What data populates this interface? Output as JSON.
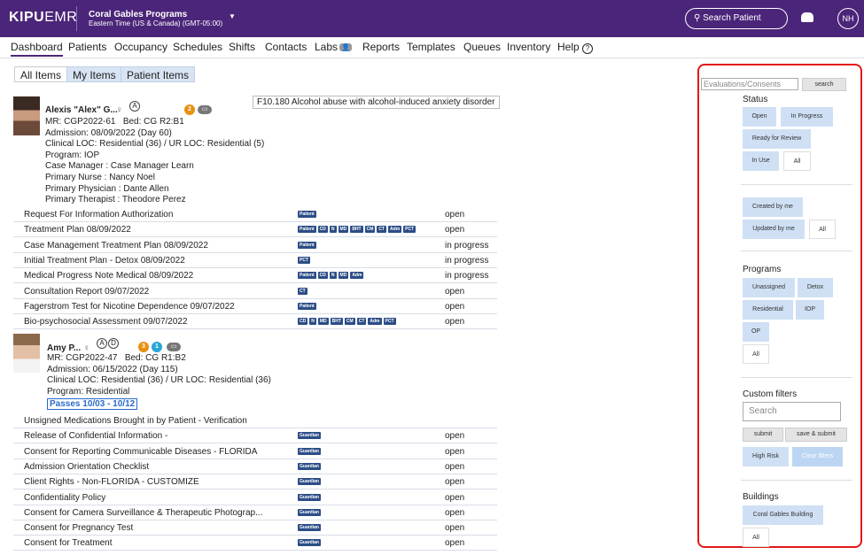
{
  "header": {
    "logo_bold": "KIPU",
    "logo_light": "EMR",
    "program_title": "Coral Gables Programs",
    "program_timezone": "Eastern Time (US & Canada) (GMT-05:00)",
    "search_patient": "Search Patient",
    "user_initials": "NH"
  },
  "nav": {
    "dashboard": "Dashboard",
    "patients": "Patients",
    "occupancy": "Occupancy",
    "schedules": "Schedules",
    "shifts": "Shifts",
    "contacts": "Contacts",
    "labs": "Labs",
    "reports": "Reports",
    "templates": "Templates",
    "queues": "Queues",
    "inventory": "Inventory",
    "help": "Help"
  },
  "tabs": {
    "all": "All Items",
    "my": "My Items",
    "patient": "Patient Items"
  },
  "patient1": {
    "name": "Alexis \"Alex\" G...",
    "mr": "MR: CGP2022-61",
    "bed": "Bed: CG R2:B1",
    "admission": "Admission: 08/09/2022 (Day 60)",
    "loc": "Clinical LOC: Residential (36) / UR LOC: Residential (5)",
    "program": "Program: IOP",
    "case_manager": "Case Manager  :  Case Manager Learn",
    "nurse": "Primary Nurse  :  Nancy Noel",
    "physician": "Primary Physician  :  Dante Allen",
    "therapist": "Primary Therapist  :  Theodore Perez",
    "badge_count": "2",
    "diagnosis": "F10.180 Alcohol abuse with alcohol-induced anxiety disorder"
  },
  "patient2": {
    "name": "Amy P...",
    "mr": "MR: CGP2022-47",
    "bed": "Bed: CG R1:B2",
    "admission": "Admission: 06/15/2022 (Day 115)",
    "loc": "Clinical LOC: Residential (36) / UR LOC: Residential (36)",
    "program": "Program: Residential",
    "passes": "Passes 10/03 - 10/12",
    "badge_orange": "3",
    "badge_blue": "1"
  },
  "docs1": [
    {
      "name": "Request For Information Authorization",
      "tags": [
        "Patient"
      ],
      "status": "open"
    },
    {
      "name": "Treatment Plan 08/09/2022",
      "tags": [
        "Patient",
        "CD",
        "N",
        "MD",
        "BHT",
        "CM",
        "CT",
        "Adm",
        "PCT"
      ],
      "status": "open"
    },
    {
      "name": "Case Management Treatment Plan 08/09/2022",
      "tags": [
        "Patient"
      ],
      "status": "in progress"
    },
    {
      "name": "Initial Treatment Plan - Detox 08/09/2022",
      "tags": [
        "PCT"
      ],
      "status": "in progress"
    },
    {
      "name": "Medical Progress Note Medical 08/09/2022",
      "tags": [
        "Patient",
        "CD",
        "N",
        "MD",
        "Adm"
      ],
      "status": "in progress"
    },
    {
      "name": "Consultation Report 09/07/2022",
      "tags": [
        "CT"
      ],
      "status": "open"
    },
    {
      "name": "Fagerstrom Test for Nicotine Dependence 09/07/2022",
      "tags": [
        "Patient"
      ],
      "status": "open"
    },
    {
      "name": "Bio-psychosocial Assessment 09/07/2022",
      "tags": [
        "CD",
        "N",
        "MD",
        "BHT",
        "CM",
        "CT",
        "Adm",
        "PCT"
      ],
      "status": "open"
    }
  ],
  "docs2": [
    {
      "name": "Unsigned Medications Brought in by Patient - Verification",
      "tags": [],
      "status": ""
    },
    {
      "name": "Release of Confidential Information -",
      "tags": [
        "Guardian"
      ],
      "status": "open"
    },
    {
      "name": "Consent for Reporting Communicable Diseases - FLORIDA",
      "tags": [
        "Guardian"
      ],
      "status": "open"
    },
    {
      "name": "Admission Orientation Checklist",
      "tags": [
        "Guardian"
      ],
      "status": "open"
    },
    {
      "name": "Client Rights - Non-FLORIDA - CUSTOMIZE",
      "tags": [
        "Guardian"
      ],
      "status": "open"
    },
    {
      "name": "Confidentiality Policy",
      "tags": [
        "Guardian"
      ],
      "status": "open"
    },
    {
      "name": "Consent for Camera Surveillance & Therapeutic Photograp...",
      "tags": [
        "Guardian"
      ],
      "status": "open"
    },
    {
      "name": "Consent for Pregnancy Test",
      "tags": [
        "Guardian"
      ],
      "status": "open"
    },
    {
      "name": "Consent for Treatment",
      "tags": [
        "Guardian"
      ],
      "status": "open"
    }
  ],
  "filters": {
    "eval_placeholder": "Evaluations/Consents",
    "search_btn": "search",
    "status_h": "Status",
    "open": "Open",
    "in_progress": "In Progress",
    "ready": "Ready for Review",
    "in_use": "In Use",
    "all": "All",
    "created_by_me": "Created by me",
    "updated_by_me": "Updated by me",
    "programs_h": "Programs",
    "unassigned": "Unassigned",
    "detox": "Detox",
    "residential": "Residential",
    "iop": "IOP",
    "op": "OP",
    "custom_h": "Custom filters",
    "search_placeholder": "Search",
    "submit": "submit",
    "save_submit": "save & submit",
    "high_risk": "High Risk",
    "clear_filters": "Clear filters",
    "buildings_h": "Buildings",
    "coral_building": "Coral Gables Building"
  }
}
